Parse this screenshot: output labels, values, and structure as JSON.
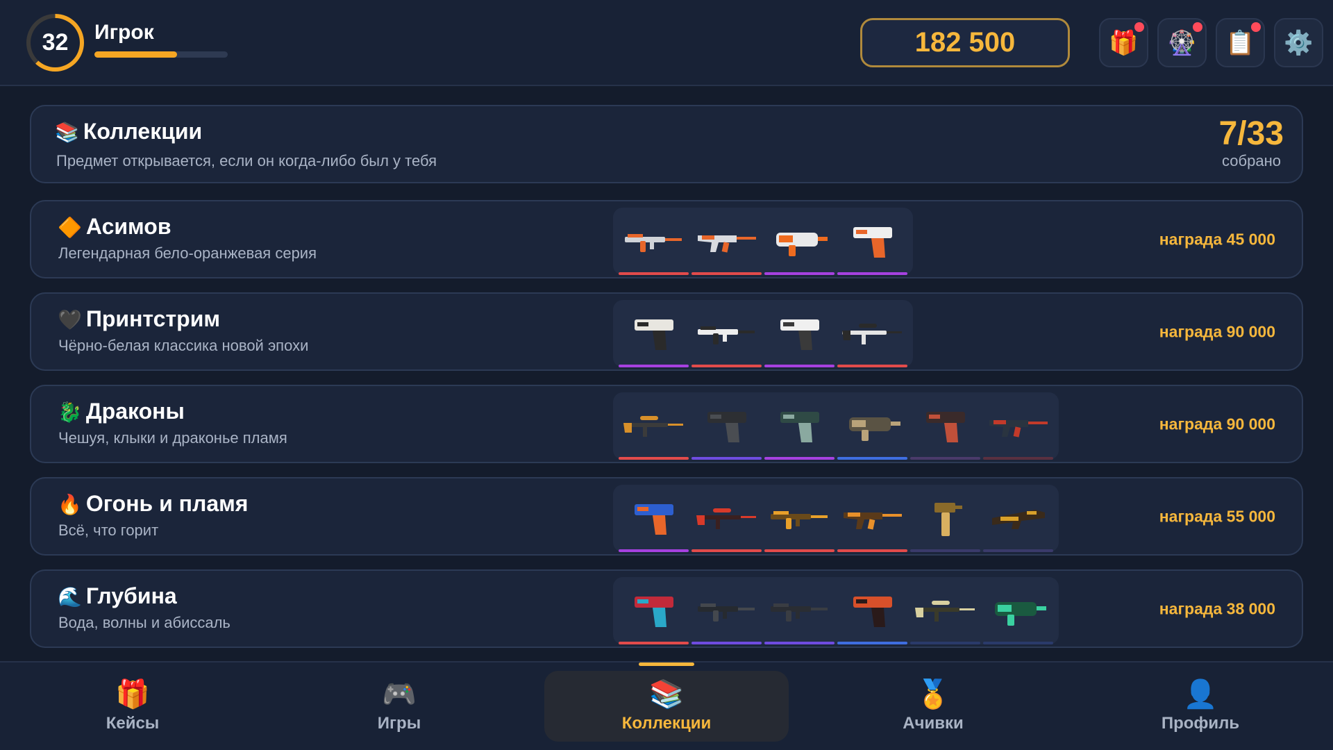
{
  "header": {
    "level": "32",
    "level_progress": 0.62,
    "player_name": "Игрок",
    "xp_progress": 0.62,
    "balance": "182 500",
    "buttons": [
      {
        "name": "gift-icon",
        "glyph": "🎁",
        "badge": true
      },
      {
        "name": "ferris-wheel-icon",
        "glyph": "🎡",
        "badge": true
      },
      {
        "name": "clipboard-icon",
        "glyph": "📋",
        "badge": true
      },
      {
        "name": "gear-icon",
        "glyph": "⚙️",
        "badge": false
      }
    ]
  },
  "summary": {
    "icon": "📚",
    "title": "Коллекции",
    "subtitle": "Предмет открывается, если он когда-либо был у тебя",
    "count": "7/33",
    "count_label": "собрано"
  },
  "collections": [
    {
      "icon": "🔶",
      "title": "Асимов",
      "subtitle": "Легендарная бело-оранжевая серия",
      "reward": "награда 45 000",
      "items": [
        {
          "weapon": "rifle",
          "color": "#d0d3d8",
          "accent": "#e8662a",
          "rarity": "#e24b4b"
        },
        {
          "weapon": "ak",
          "color": "#d9dbe0",
          "accent": "#e8662a",
          "rarity": "#e24b4b"
        },
        {
          "weapon": "smg",
          "color": "#e9e9ea",
          "accent": "#ef6b1f",
          "rarity": "#a641e0"
        },
        {
          "weapon": "pistol",
          "color": "#efefef",
          "accent": "#e8662a",
          "rarity": "#a641e0"
        }
      ]
    },
    {
      "icon": "🖤",
      "title": "Принтстрим",
      "subtitle": "Чёрно-белая классика новой эпохи",
      "reward": "награда 90 000",
      "items": [
        {
          "weapon": "pistol",
          "color": "#e8e6e0",
          "accent": "#2a2a2a",
          "rarity": "#a641e0"
        },
        {
          "weapon": "rifle",
          "color": "#eeeeee",
          "accent": "#2a2a2a",
          "rarity": "#e24b4b"
        },
        {
          "weapon": "pistol",
          "color": "#f0f0f0",
          "accent": "#3a3a3a",
          "rarity": "#a641e0"
        },
        {
          "weapon": "sniper",
          "color": "#e4e4e4",
          "accent": "#2a2a2a",
          "rarity": "#e24b4b"
        }
      ]
    },
    {
      "icon": "🐉",
      "title": "Драконы",
      "subtitle": "Чешуя, клыки и драконье пламя",
      "reward": "награда 90 000",
      "items": [
        {
          "weapon": "sniper",
          "color": "#3b3b3b",
          "accent": "#d8902a",
          "rarity": "#e24b4b"
        },
        {
          "weapon": "pistol",
          "color": "#2d2f33",
          "accent": "#4a4d52",
          "rarity": "#6f4ce0"
        },
        {
          "weapon": "pistol",
          "color": "#2f4a45",
          "accent": "#8aa9a0",
          "rarity": "#a641e0"
        },
        {
          "weapon": "smg",
          "color": "#5a5344",
          "accent": "#b9a37a",
          "rarity": "#3f6ee0"
        },
        {
          "weapon": "pistol",
          "color": "#3a2a2a",
          "accent": "#c0503a",
          "rarity": "#4a3a6a"
        },
        {
          "weapon": "ak",
          "color": "#2a3440",
          "accent": "#c23a2a",
          "rarity": "#5a3040"
        }
      ]
    },
    {
      "icon": "🔥",
      "title": "Огонь и пламя",
      "subtitle": "Всё, что горит",
      "reward": "награда 55 000",
      "items": [
        {
          "weapon": "pistol",
          "color": "#2d5fd0",
          "accent": "#e8662a",
          "rarity": "#a641e0"
        },
        {
          "weapon": "sniper",
          "color": "#3a2020",
          "accent": "#d83a2a",
          "rarity": "#e24b4b"
        },
        {
          "weapon": "rifle",
          "color": "#6a4a1a",
          "accent": "#e8a02a",
          "rarity": "#e24b4b"
        },
        {
          "weapon": "ak",
          "color": "#5a3a1a",
          "accent": "#e8902a",
          "rarity": "#e24b4b"
        },
        {
          "weapon": "mac",
          "color": "#8a6a2a",
          "accent": "#d9b060",
          "rarity": "#3a3a6a"
        },
        {
          "weapon": "bullpup",
          "color": "#3a2a1a",
          "accent": "#d8a02a",
          "rarity": "#3a3a6a"
        }
      ]
    },
    {
      "icon": "🌊",
      "title": "Глубина",
      "subtitle": "Вода, волны и абиссаль",
      "reward": "награда 38 000",
      "items": [
        {
          "weapon": "pistol",
          "color": "#c22a3a",
          "accent": "#2aa8c8",
          "rarity": "#e24b4b"
        },
        {
          "weapon": "rifle",
          "color": "#262a30",
          "accent": "#44484e",
          "rarity": "#6f4ce0"
        },
        {
          "weapon": "rifle",
          "color": "#2a2d33",
          "accent": "#3a3d43",
          "rarity": "#6f4ce0"
        },
        {
          "weapon": "pistol",
          "color": "#d8502a",
          "accent": "#2a1a1a",
          "rarity": "#3f6ee0"
        },
        {
          "weapon": "sniper",
          "color": "#3a3a2a",
          "accent": "#d8d0a0",
          "rarity": "#2a3a6a"
        },
        {
          "weapon": "smg",
          "color": "#1a5a40",
          "accent": "#3ad0a0",
          "rarity": "#2a3a6a"
        }
      ]
    }
  ],
  "nav": [
    {
      "name": "nav-cases",
      "icon_name": "gift-icon",
      "glyph": "🎁",
      "label": "Кейсы",
      "active": false
    },
    {
      "name": "nav-games",
      "icon_name": "gamepad-icon",
      "glyph": "🎮",
      "label": "Игры",
      "active": false
    },
    {
      "name": "nav-collections",
      "icon_name": "books-icon",
      "glyph": "📚",
      "label": "Коллекции",
      "active": true
    },
    {
      "name": "nav-achievements",
      "icon_name": "medal-icon",
      "glyph": "🏅",
      "label": "Ачивки",
      "active": false
    },
    {
      "name": "nav-profile",
      "icon_name": "user-icon",
      "glyph": "👤",
      "label": "Профиль",
      "active": false
    }
  ]
}
